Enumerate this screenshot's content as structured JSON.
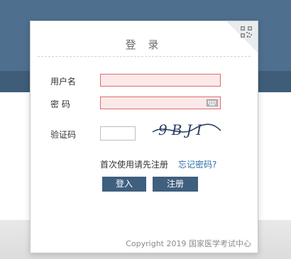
{
  "dialog": {
    "title": "登 录",
    "username_label": "用户名",
    "password_label": "密 码",
    "captcha_label": "验证码",
    "captcha_text": "9BJI",
    "username_value": "",
    "password_value": "",
    "captcha_value": "",
    "hint_text": "首次使用请先注册",
    "forgot_link": "忘记密码?",
    "login_button": "登入",
    "register_button": "注册",
    "copyright": "Copyright 2019 国家医学考试中心"
  },
  "colors": {
    "header_bg": "#4f6f8f",
    "button_bg": "#3f5f7f",
    "field_border": "#e06b6b",
    "field_bg": "#fbe9ea",
    "link": "#2d6da8"
  }
}
